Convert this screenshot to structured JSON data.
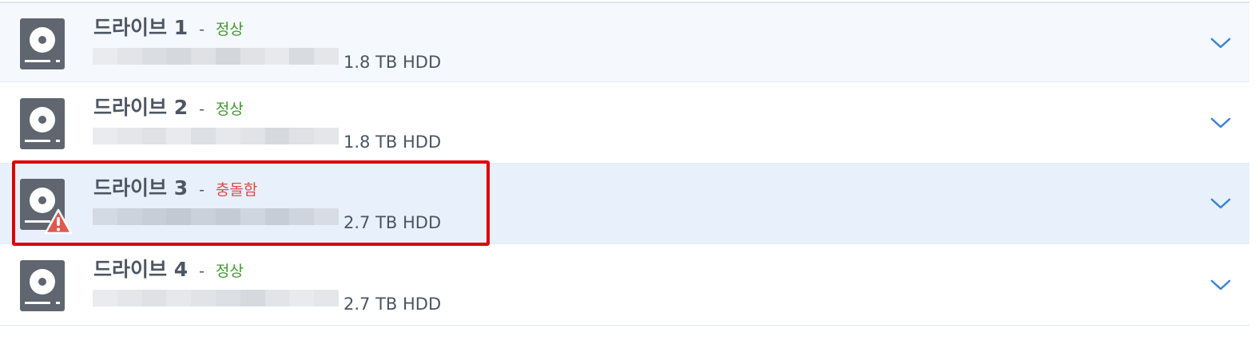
{
  "colors": {
    "status_ok": "#3f9a2e",
    "status_error": "#e04a4a",
    "chevron": "#3d82d6",
    "icon_body": "#5f6670",
    "highlight": "#dd0000"
  },
  "drives": [
    {
      "name": "드라이브 1",
      "separator": "-",
      "status": "정상",
      "status_type": "ok",
      "capacity": "1.8 TB HDD",
      "icon": "hard-drive-icon",
      "warning": false
    },
    {
      "name": "드라이브 2",
      "separator": "-",
      "status": "정상",
      "status_type": "ok",
      "capacity": "1.8 TB HDD",
      "icon": "hard-drive-icon",
      "warning": false
    },
    {
      "name": "드라이브 3",
      "separator": "-",
      "status": "충돌함",
      "status_type": "error",
      "capacity": "2.7 TB HDD",
      "icon": "hard-drive-icon",
      "warning": true
    },
    {
      "name": "드라이브 4",
      "separator": "-",
      "status": "정상",
      "status_type": "ok",
      "capacity": "2.7 TB HDD",
      "icon": "hard-drive-icon",
      "warning": false
    }
  ],
  "expand_icon": "chevron-down-icon"
}
